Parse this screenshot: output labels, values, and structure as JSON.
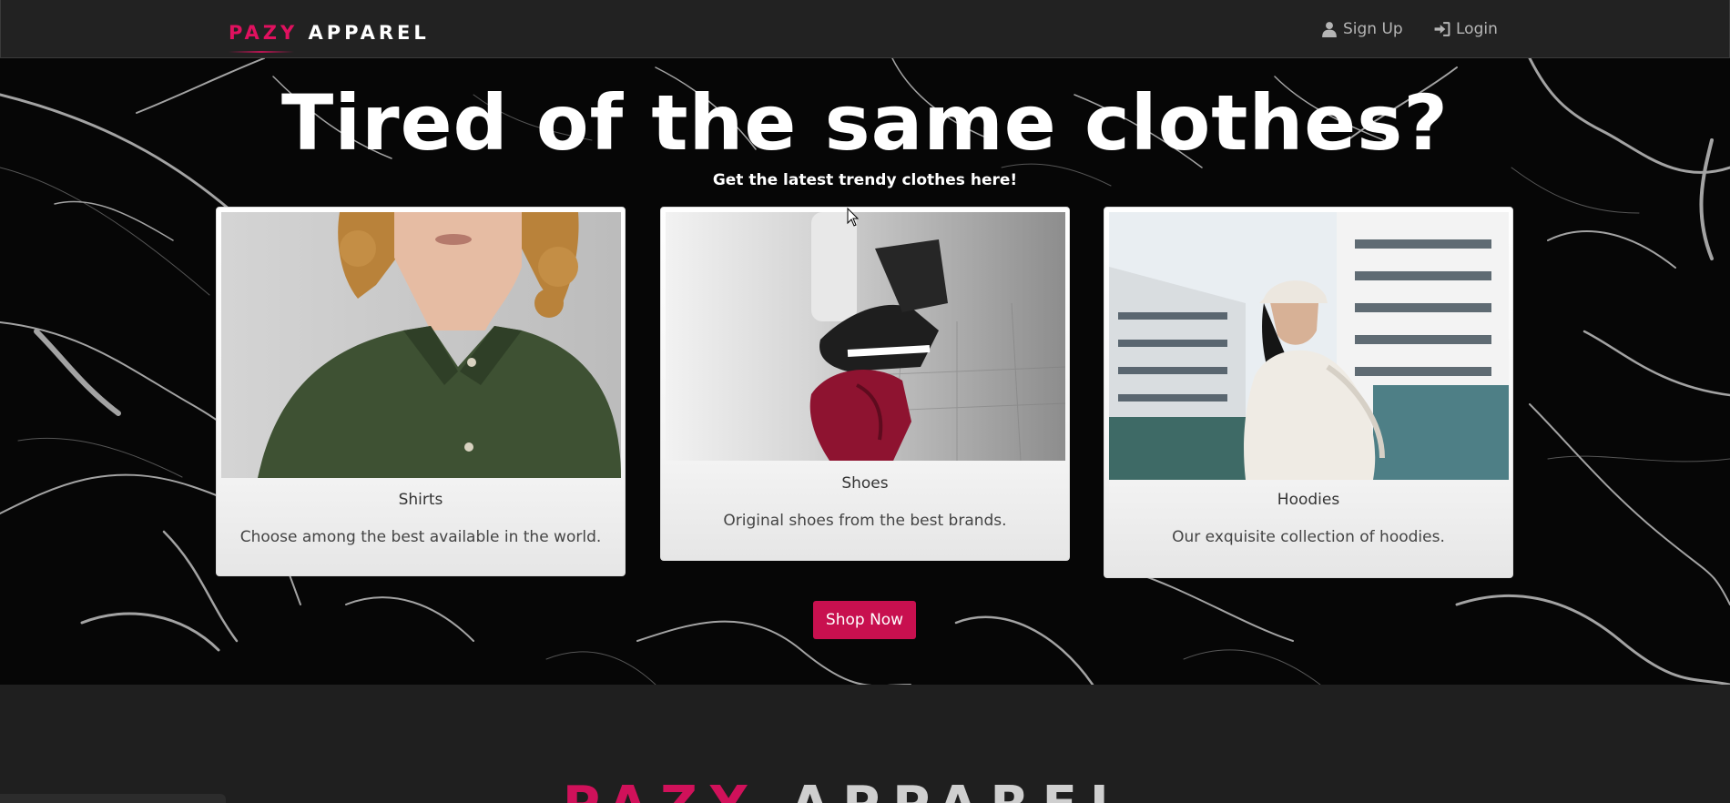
{
  "navbar": {
    "brand_part1": "PAZY",
    "brand_part2": "APPAREL",
    "signup_label": "Sign Up",
    "login_label": "Login",
    "signup_icon": "user-icon",
    "login_icon": "login-icon"
  },
  "hero": {
    "title": "Tired of the same clothes?",
    "subtitle": "Get the latest trendy clothes here!",
    "cards": [
      {
        "title": "Shirts",
        "text": "Choose among the best available in the world."
      },
      {
        "title": "Shoes",
        "text": "Original shoes from the best brands."
      },
      {
        "title": "Hoodies",
        "text": "Our exquisite collection of hoodies."
      }
    ],
    "cta_label": "Shop Now"
  },
  "footer": {
    "brand_part1": "PAZY",
    "brand_part2": "APPAREL"
  },
  "colors": {
    "accent": "#e0115f",
    "navbar_bg": "#222222",
    "button_bg": "#c8104f"
  }
}
